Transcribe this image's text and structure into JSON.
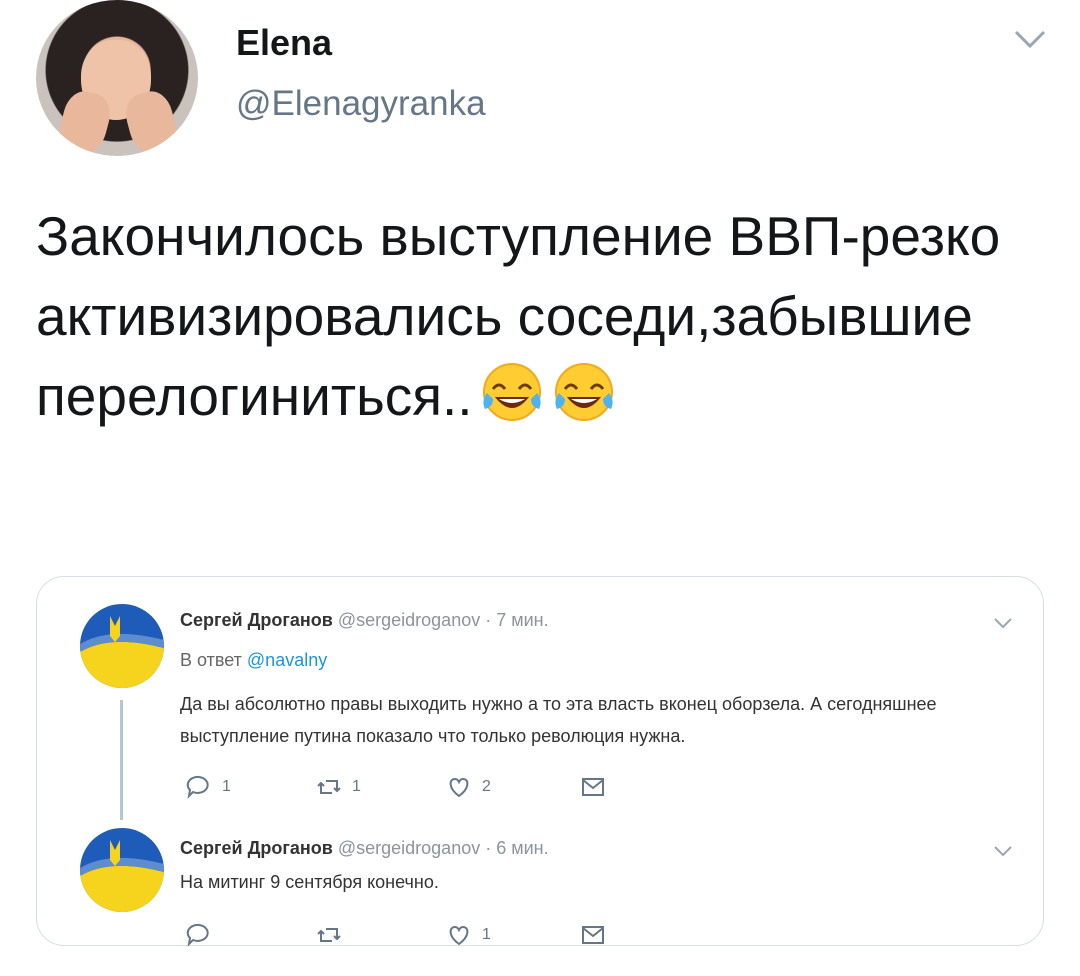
{
  "author": {
    "name": "Elena",
    "handle": "@Elenagyranka"
  },
  "tweet": {
    "text": "Закончилось выступление ВВП-резко активизировались соседи,забывшие перелогиниться..",
    "emoji": [
      "face-with-tears-of-joy",
      "face-with-tears-of-joy"
    ]
  },
  "quoted": {
    "reply1": {
      "name": "Сергей Дроганов",
      "meta": "@sergeidroganov · 7 мин.",
      "reply_prefix": "В ответ",
      "reply_handle": "@navalny",
      "body": "Да вы абсолютно правы выходить нужно а то эта власть вконец оборзела. А сегодняшнее выступление путина показало что только революция нужна.",
      "replies": "1",
      "retweets": "1",
      "likes": "2"
    },
    "reply2": {
      "name": "Сергей Дроганов",
      "meta": "@sergeidroganov · 6 мин.",
      "body": "На митинг 9 сентября конечно.",
      "replies": "",
      "retweets": "",
      "likes": "1"
    }
  },
  "colors": {
    "accent": "#1b95e0",
    "muted": "#657786",
    "flag_blue": "#1f5bb8",
    "flag_yellow": "#f6d31c"
  }
}
